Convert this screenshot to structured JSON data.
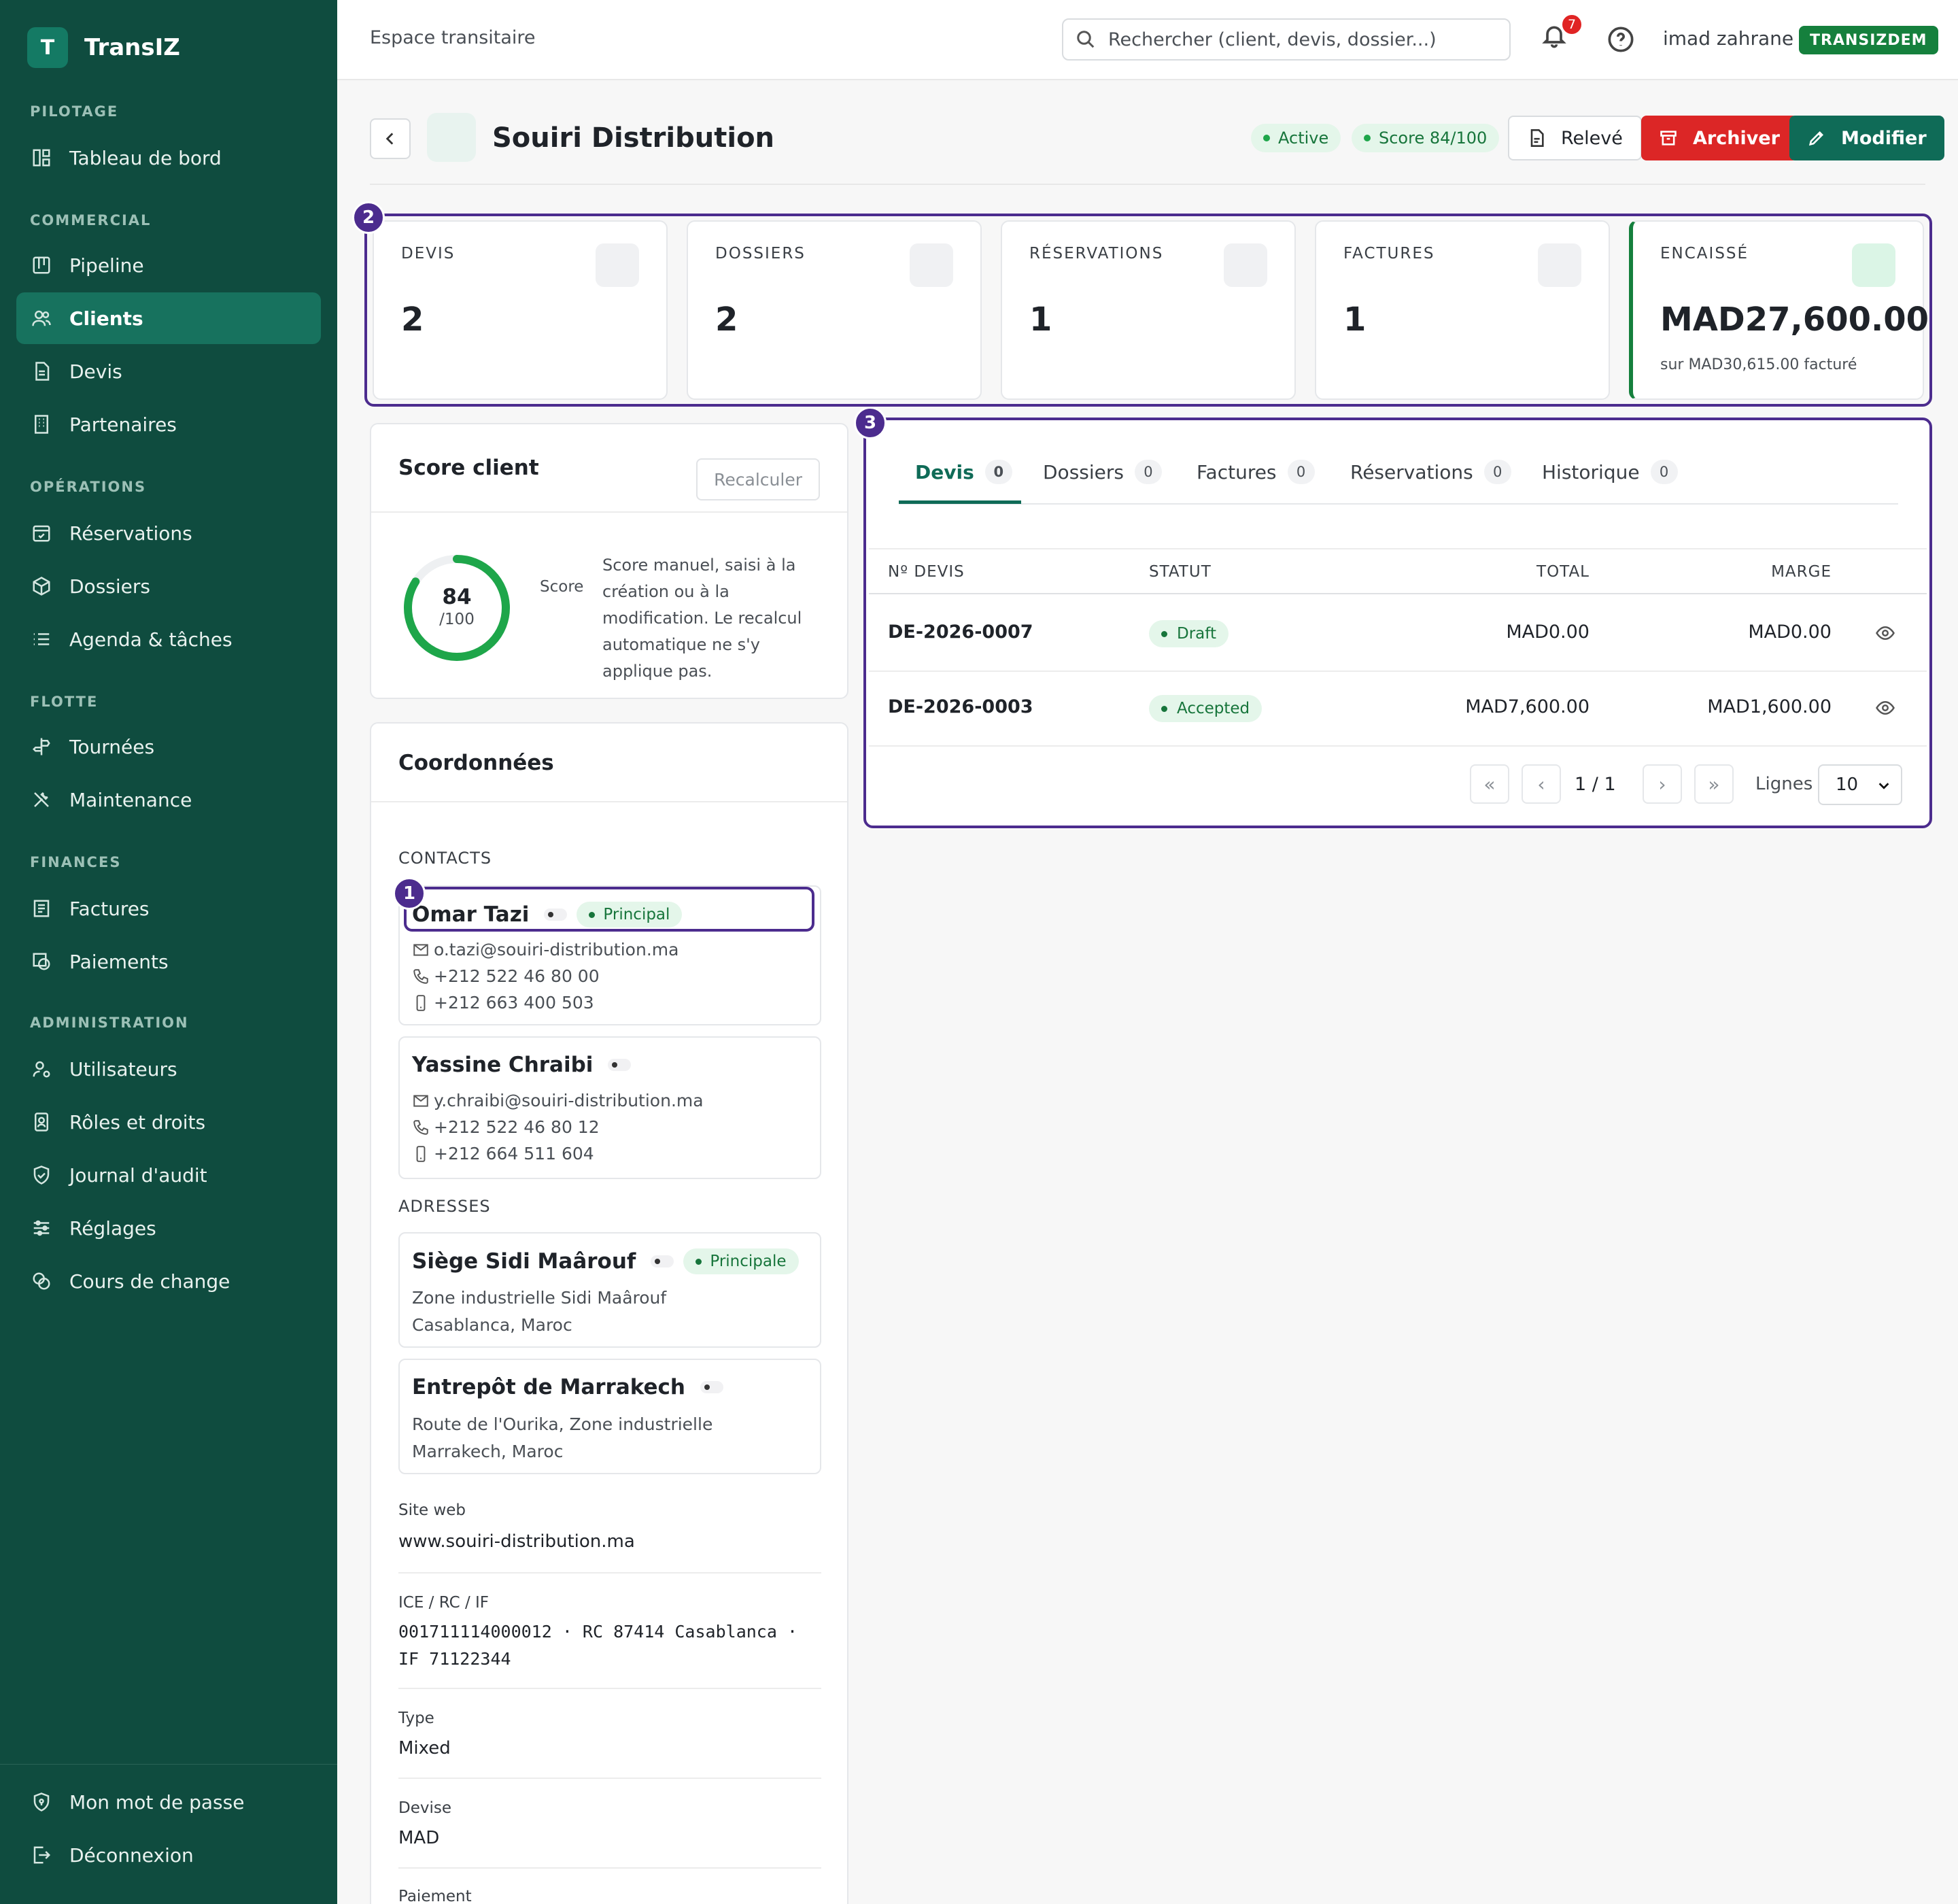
{
  "app": {
    "logo_letter": "T",
    "name": "TransIZ"
  },
  "sidebar": {
    "sections": [
      {
        "label": "PILOTAGE"
      },
      {
        "label": "COMMERCIAL"
      },
      {
        "label": "OPÉRATIONS"
      },
      {
        "label": "FLOTTE"
      },
      {
        "label": "FINANCES"
      },
      {
        "label": "ADMINISTRATION"
      }
    ],
    "items": [
      {
        "label": "Tableau de bord",
        "icon": "dashboard-icon"
      },
      {
        "label": "Pipeline",
        "icon": "pipeline-icon"
      },
      {
        "label": "Clients",
        "icon": "users-icon",
        "active": true
      },
      {
        "label": "Devis",
        "icon": "document-icon"
      },
      {
        "label": "Partenaires",
        "icon": "building-icon"
      },
      {
        "label": "Réservations",
        "icon": "calendar-check-icon"
      },
      {
        "label": "Dossiers",
        "icon": "box-icon"
      },
      {
        "label": "Agenda & tâches",
        "icon": "list-icon"
      },
      {
        "label": "Tournées",
        "icon": "signpost-icon"
      },
      {
        "label": "Maintenance",
        "icon": "tools-icon"
      },
      {
        "label": "Factures",
        "icon": "invoice-icon"
      },
      {
        "label": "Paiements",
        "icon": "payment-icon"
      },
      {
        "label": "Utilisateurs",
        "icon": "user-gear-icon"
      },
      {
        "label": "Rôles et droits",
        "icon": "id-badge-icon"
      },
      {
        "label": "Journal d'audit",
        "icon": "shield-check-icon"
      },
      {
        "label": "Réglages",
        "icon": "sliders-icon"
      },
      {
        "label": "Cours de change",
        "icon": "coins-icon"
      }
    ],
    "footer": [
      {
        "label": "Mon mot de passe",
        "icon": "shield-lock-icon"
      },
      {
        "label": "Déconnexion",
        "icon": "logout-icon"
      }
    ]
  },
  "topbar": {
    "title": "Espace transitaire",
    "search_placeholder": "Rechercher (client, devis, dossier...)",
    "notifications": "7",
    "user": "imad zahrane",
    "tenant": "TRANSIZDEM"
  },
  "client": {
    "name": "Souiri Distribution",
    "status": "Active",
    "score_pill": "Score 84/100",
    "actions": {
      "releve": "Relevé",
      "archive": "Archiver",
      "edit": "Modifier"
    }
  },
  "steps": {
    "one": "1",
    "two": "2",
    "three": "3"
  },
  "stats": [
    {
      "label": "DEVIS",
      "value": "2"
    },
    {
      "label": "DOSSIERS",
      "value": "2"
    },
    {
      "label": "RÉSERVATIONS",
      "value": "1"
    },
    {
      "label": "FACTURES",
      "value": "1"
    },
    {
      "label": "ENCAISSÉ",
      "value": "MAD27,600.00",
      "sub": "sur MAD30,615.00 facturé"
    }
  ],
  "score_card": {
    "title": "Score client",
    "recalc": "Recalculer",
    "score": 84,
    "score_text": "84",
    "score_max": "/100",
    "label": "Score",
    "description": "Score manuel, saisi à la création ou à la modification. Le recalcul automatique ne s'y applique pas.",
    "color": "#1ea64a"
  },
  "coords": {
    "title": "Coordonnées",
    "contacts_title": "CONTACTS",
    "contacts": [
      {
        "name": "Omar Tazi",
        "tag": "Principal",
        "email": "o.tazi@souiri-distribution.ma",
        "phone": "+212 522 46 80 00",
        "mobile": "+212 663 400 503"
      },
      {
        "name": "Yassine Chraibi",
        "email": "y.chraibi@souiri-distribution.ma",
        "phone": "+212 522 46 80 12",
        "mobile": "+212 664 511 604"
      }
    ],
    "addresses_title": "ADRESSES",
    "addresses": [
      {
        "name": "Siège Sidi Maârouf",
        "tag": "Principale",
        "line1": "Zone industrielle Sidi Maârouf",
        "line2": "Casablanca, Maroc"
      },
      {
        "name": "Entrepôt de Marrakech",
        "line1": "Route de l'Ourika, Zone industrielle",
        "line2": "Marrakech, Maroc"
      }
    ],
    "fields": {
      "website_label": "Site web",
      "website": "www.souiri-distribution.ma",
      "ids_label": "ICE / RC / IF",
      "ids": "001711114000012 · RC 87414 Casablanca · IF 71122344",
      "type_label": "Type",
      "type": "Mixed",
      "currency_label": "Devise",
      "currency": "MAD",
      "payment_label": "Paiement"
    }
  },
  "tabs": [
    {
      "label": "Devis",
      "count": "0",
      "active": true
    },
    {
      "label": "Dossiers",
      "count": "0"
    },
    {
      "label": "Factures",
      "count": "0"
    },
    {
      "label": "Réservations",
      "count": "0"
    },
    {
      "label": "Historique",
      "count": "0"
    }
  ],
  "table": {
    "headers": {
      "id": "Nº DEVIS",
      "status": "STATUT",
      "total": "TOTAL",
      "margin": "MARGE"
    },
    "rows": [
      {
        "id": "DE-2026-0007",
        "status": "Draft",
        "total": "MAD0.00",
        "margin": "MAD0.00"
      },
      {
        "id": "DE-2026-0003",
        "status": "Accepted",
        "total": "MAD7,600.00",
        "margin": "MAD1,600.00"
      }
    ],
    "pagination": {
      "first": "«",
      "prev": "‹",
      "info": "1 / 1",
      "next": "›",
      "last": "»",
      "rows_label": "Lignes",
      "rows_value": "10"
    }
  }
}
